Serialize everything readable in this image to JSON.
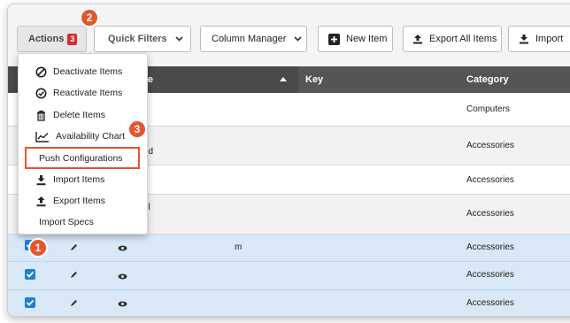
{
  "toolbar": {
    "actions_label": "Actions",
    "actions_count": "3",
    "quick_filters_label": "Quick Filters",
    "column_manager_label": "Column Manager",
    "new_item_label": "New Item",
    "export_all_label": "Export All Items",
    "import_label": "Import"
  },
  "table": {
    "header": {
      "name_col": "Name",
      "key_col": "Key",
      "category_col": "Category"
    },
    "rows": [
      {
        "name_frag": "",
        "key": "",
        "category": "Computers",
        "selected": false
      },
      {
        "name_frag": "nd",
        "key": "",
        "category": "Accessories",
        "selected": false
      },
      {
        "name_frag": "",
        "key": "",
        "category": "Accessories",
        "selected": false
      },
      {
        "name_frag": "el",
        "key": "",
        "category": "Accessories",
        "selected": false
      },
      {
        "name_frag": "",
        "key": "m",
        "category": "Accessories",
        "selected": true
      },
      {
        "name_frag": "",
        "key": "",
        "category": "Accessories",
        "selected": true
      },
      {
        "name_frag": "",
        "key": "",
        "category": "Accessories",
        "selected": true
      }
    ]
  },
  "actions_menu": {
    "items": [
      {
        "label": "Deactivate Items",
        "icon": "deactivate-icon"
      },
      {
        "label": "Reactivate Items",
        "icon": "reactivate-icon"
      },
      {
        "label": "Delete Items",
        "icon": "trash-icon"
      },
      {
        "label": "Availability Chart",
        "icon": "line-chart-icon"
      },
      {
        "label": "Push Configurations",
        "icon": ""
      },
      {
        "label": "Import Items",
        "icon": "download-icon"
      },
      {
        "label": "Export Items",
        "icon": "upload-icon"
      },
      {
        "label": "Import Specs",
        "icon": ""
      }
    ]
  },
  "callouts": [
    "1",
    "2",
    "3"
  ],
  "colors": {
    "accent": "#e8542c",
    "selection": "#d8e8f7",
    "checkbox": "#1f7fd6",
    "badge_red": "#d62d2d"
  }
}
